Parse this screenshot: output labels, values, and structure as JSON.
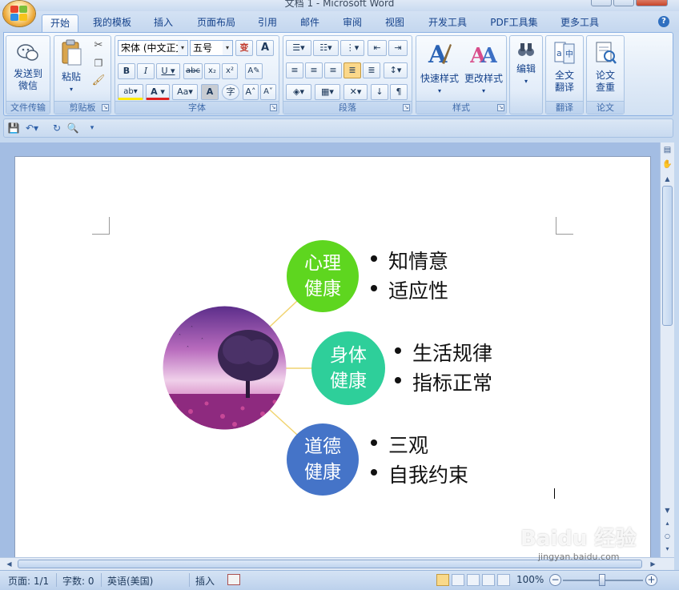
{
  "window": {
    "title": "文档 1 - Microsoft Word"
  },
  "tabs": [
    "开始",
    "我的模板",
    "插入",
    "页面布局",
    "引用",
    "邮件",
    "审阅",
    "视图",
    "开发工具",
    "PDF工具集",
    "更多工具"
  ],
  "ribbon": {
    "groups": {
      "wenjian": {
        "label": "文件传输",
        "send_label_1": "发送到",
        "send_label_2": "微信"
      },
      "clipboard": {
        "label": "剪贴板",
        "paste_label": "粘贴"
      },
      "font": {
        "label": "字体",
        "font_name": "宋体 (中文正文)",
        "font_size": "五号"
      },
      "paragraph": {
        "label": "段落"
      },
      "styles": {
        "label": "样式",
        "quick_styles": "快速样式",
        "change_styles": "更改样式"
      },
      "edit": {
        "label": "编辑"
      },
      "translate": {
        "label": "翻译",
        "full_text_1": "全文",
        "full_text_2": "翻译"
      },
      "paper": {
        "label": "论文",
        "check_1": "论文",
        "check_2": "查重"
      }
    }
  },
  "document": {
    "smartart": {
      "nodes": [
        {
          "title_1": "心理",
          "title_2": "健康",
          "color": "#5ed61f",
          "bullets": [
            "知情意",
            "适应性"
          ]
        },
        {
          "title_1": "身体",
          "title_2": "健康",
          "color": "#2ecf9a",
          "bullets": [
            "生活规律",
            "指标正常"
          ]
        },
        {
          "title_1": "道德",
          "title_2": "健康",
          "color": "#4574c8",
          "bullets": [
            "三观",
            "自我约束"
          ]
        }
      ],
      "connector_color": "#f1d470"
    }
  },
  "statusbar": {
    "page": "页面: 1/1",
    "words": "字数: 0",
    "language": "英语(美国)",
    "mode": "插入",
    "zoom": "100%"
  },
  "watermark": {
    "brand": "Baidu 经验",
    "url": "jingyan.baidu.com"
  }
}
